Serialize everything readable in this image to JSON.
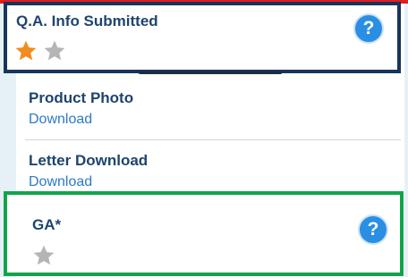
{
  "qa_section": {
    "title": "Q.A. Info Submitted",
    "rating": 1,
    "rating_max": 2,
    "help_glyph": "?"
  },
  "product_photo": {
    "title": "Product Photo",
    "link": "Download"
  },
  "letter_download": {
    "title": "Letter Download",
    "link": "Download"
  },
  "ga_section": {
    "title": "GA*",
    "rating": 0,
    "rating_max": 1,
    "help_glyph": "?"
  },
  "colors": {
    "accent_red": "#e51c1c",
    "qa_border": "#17345e",
    "ga_border": "#13a44a",
    "title_text": "#1e446e",
    "link_text": "#2c7bc4",
    "star_filled": "#f28c1f",
    "star_empty": "#b5b5b5",
    "help_button": "#2a8ee3"
  },
  "icons": {
    "star_filled": "star-filled-icon",
    "star_empty": "star-empty-icon",
    "help": "question-mark-icon"
  }
}
